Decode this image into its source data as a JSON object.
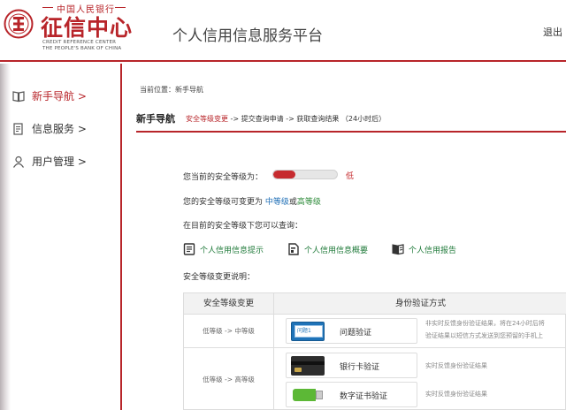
{
  "header": {
    "logo_top": "中国人民银行",
    "logo_main": "征信中心",
    "logo_en_line1": "CREDIT REFERENCE CENTER",
    "logo_en_line2": "THE PEOPLE'S BANK OF CHINA",
    "platform_title": "个人信用信息服务平台",
    "logout_label": "退出"
  },
  "sidebar": {
    "items": [
      {
        "label": "新手导航 >",
        "icon": "book-icon",
        "active": true
      },
      {
        "label": "信息服务 >",
        "icon": "document-icon",
        "active": false
      },
      {
        "label": "用户管理 >",
        "icon": "user-icon",
        "active": false
      }
    ]
  },
  "breadcrumb": "当前位置：新手导航",
  "guide": {
    "title": "新手导航",
    "step1": "安全等级变更",
    "step_rest": " -> 提交查询申请 -> 获取查询结果 （24小时后）"
  },
  "security": {
    "current_label": "您当前的安全等级为：",
    "level_percent": 35,
    "level_text": "低",
    "change_prefix": "您的安全等级可变更为 ",
    "change_medium": "中等级",
    "change_or": "或",
    "change_high": "高等级",
    "query_intro": "在目前的安全等级下您可以查询：",
    "queries": [
      {
        "label": "个人信用信息提示",
        "icon": "report-list-icon"
      },
      {
        "label": "个人信用信息概要",
        "icon": "document-edit-icon"
      },
      {
        "label": "个人信用报告",
        "icon": "open-book-icon"
      }
    ],
    "explain_title": "安全等级变更说明："
  },
  "table": {
    "header_change": "安全等级变更",
    "header_method": "身份验证方式",
    "rows": [
      {
        "change": "低等级  ->  中等级",
        "methods": [
          {
            "label": "问题验证",
            "icon": "question-card-icon",
            "icon_text": "问题1",
            "desc_line1": "非实时反馈身份验证结果，将在24小时后将",
            "desc_line2": "验证结果以短信方式发送到您预留的手机上"
          }
        ]
      },
      {
        "change": "低等级  ->  高等级",
        "methods": [
          {
            "label": "银行卡验证",
            "icon": "bank-card-icon",
            "desc_line1": "实时反馈身份验证结果"
          },
          {
            "label": "数字证书验证",
            "icon": "usb-key-icon",
            "desc_line1": "实时反馈身份验证结果"
          }
        ]
      }
    ]
  },
  "colors": {
    "brand_red": "#b8252a",
    "link_green": "#1f7a3a",
    "link_blue": "#1f6fb6"
  }
}
